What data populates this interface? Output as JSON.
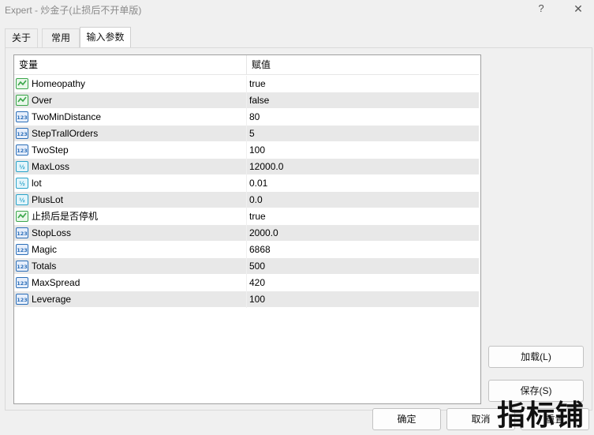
{
  "window": {
    "title": "Expert - 炒金子(止损后不开单版)",
    "help_label": "?",
    "close_label": "✕"
  },
  "tabs": [
    {
      "label": "关于"
    },
    {
      "label": "常用"
    },
    {
      "label": "输入参数",
      "active": true
    }
  ],
  "table": {
    "columns": {
      "variable": "变量",
      "value": "赋值"
    },
    "rows": [
      {
        "icon": "bool-icon",
        "name": "Homeopathy",
        "value": "true"
      },
      {
        "icon": "bool-icon",
        "name": "Over",
        "value": "false"
      },
      {
        "icon": "int-icon",
        "name": "TwoMinDistance",
        "value": "80"
      },
      {
        "icon": "int-icon",
        "name": "StepTrallOrders",
        "value": "5"
      },
      {
        "icon": "int-icon",
        "name": "TwoStep",
        "value": "100"
      },
      {
        "icon": "double-icon",
        "name": "MaxLoss",
        "value": "12000.0"
      },
      {
        "icon": "double-icon",
        "name": "lot",
        "value": "0.01"
      },
      {
        "icon": "double-icon",
        "name": "PlusLot",
        "value": "0.0"
      },
      {
        "icon": "bool-icon",
        "name": "止损后是否停机",
        "value": "true"
      },
      {
        "icon": "int-icon",
        "name": "StopLoss",
        "value": "2000.0"
      },
      {
        "icon": "int-icon",
        "name": "Magic",
        "value": "6868"
      },
      {
        "icon": "int-icon",
        "name": "Totals",
        "value": "500"
      },
      {
        "icon": "int-icon",
        "name": "MaxSpread",
        "value": "420"
      },
      {
        "icon": "int-icon",
        "name": "Leverage",
        "value": "100"
      }
    ]
  },
  "buttons": {
    "load": "加载(L)",
    "save": "保存(S)",
    "ok": "确定",
    "cancel": "取消",
    "reset": "重置"
  },
  "watermark": "指标铺",
  "colors": {
    "bool_icon": "#3aa64a",
    "int_icon": "#2c6fb8",
    "double_icon": "#2aa3c9"
  }
}
